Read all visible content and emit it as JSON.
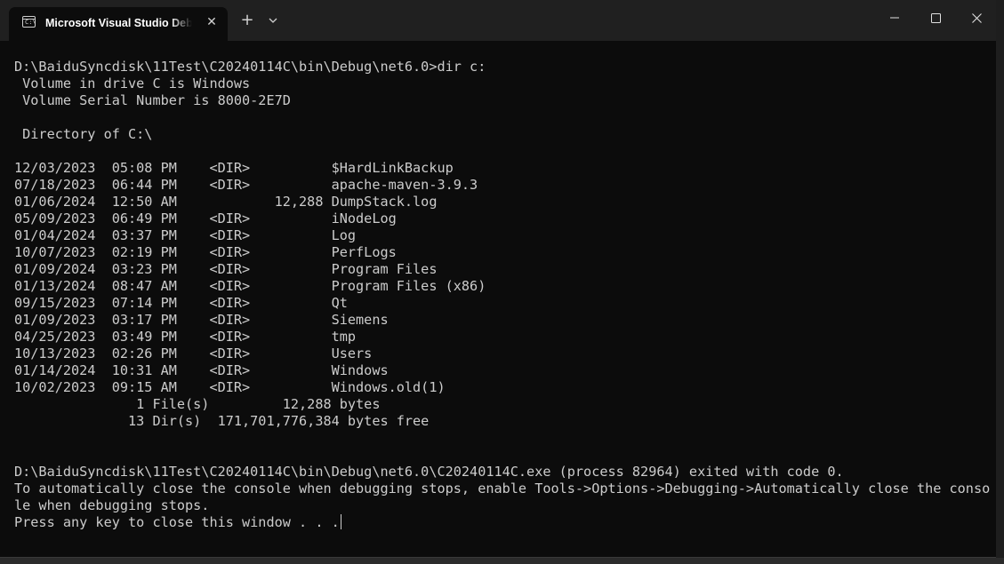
{
  "window": {
    "tab_title": "Microsoft Visual Studio Debug Console",
    "tab_icon_glyph": "C:\\",
    "close_tab_glyph": "✕",
    "new_tab_glyph": "+",
    "controls": {
      "minimize": "minimize-icon",
      "maximize": "maximize-icon",
      "close": "close-icon"
    }
  },
  "terminal": {
    "lines": [
      "D:\\BaiduSyncdisk\\11Test\\C20240114C\\bin\\Debug\\net6.0>dir c:",
      " Volume in drive C is Windows",
      " Volume Serial Number is 8000-2E7D",
      "",
      " Directory of C:\\",
      "",
      "12/03/2023  05:08 PM    <DIR>          $HardLinkBackup",
      "07/18/2023  06:44 PM    <DIR>          apache-maven-3.9.3",
      "01/06/2024  12:50 AM            12,288 DumpStack.log",
      "05/09/2023  06:49 PM    <DIR>          iNodeLog",
      "01/04/2024  03:37 PM    <DIR>          Log",
      "10/07/2023  02:19 PM    <DIR>          PerfLogs",
      "01/09/2024  03:23 PM    <DIR>          Program Files",
      "01/13/2024  08:47 AM    <DIR>          Program Files (x86)",
      "09/15/2023  07:14 PM    <DIR>          Qt",
      "01/09/2023  03:17 PM    <DIR>          Siemens",
      "04/25/2023  03:49 PM    <DIR>          tmp",
      "10/13/2023  02:26 PM    <DIR>          Users",
      "01/14/2024  10:31 AM    <DIR>          Windows",
      "10/02/2023  09:15 AM    <DIR>          Windows.old(1)",
      "               1 File(s)         12,288 bytes",
      "              13 Dir(s)  171,701,776,384 bytes free",
      "",
      "",
      "D:\\BaiduSyncdisk\\11Test\\C20240114C\\bin\\Debug\\net6.0\\C20240114C.exe (process 82964) exited with code 0.",
      "To automatically close the console when debugging stops, enable Tools->Options->Debugging->Automatically close the conso",
      "le when debugging stops.",
      "Press any key to close this window . . ."
    ]
  },
  "colors": {
    "console_bg": "#0c0c0c",
    "titlebar_bg": "#202020",
    "text": "#cccccc"
  }
}
